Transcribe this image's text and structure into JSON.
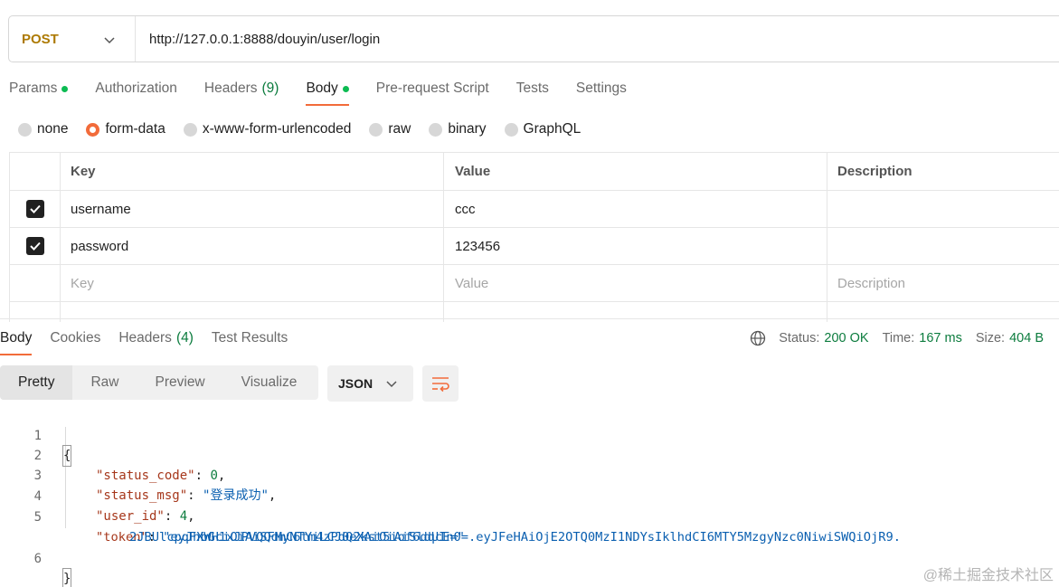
{
  "request": {
    "method": "POST",
    "url": "http://127.0.0.1:8888/douyin/user/login"
  },
  "request_tabs": [
    {
      "label": "Params",
      "dot": true
    },
    {
      "label": "Authorization"
    },
    {
      "label": "Headers",
      "count": "(9)"
    },
    {
      "label": "Body",
      "dot": true,
      "active": true
    },
    {
      "label": "Pre-request Script"
    },
    {
      "label": "Tests"
    },
    {
      "label": "Settings"
    }
  ],
  "body_types": [
    {
      "label": "none"
    },
    {
      "label": "form-data",
      "selected": true
    },
    {
      "label": "x-www-form-urlencoded"
    },
    {
      "label": "raw"
    },
    {
      "label": "binary"
    },
    {
      "label": "GraphQL"
    }
  ],
  "params_table": {
    "headers": {
      "key": "Key",
      "value": "Value",
      "description": "Description"
    },
    "rows": [
      {
        "checked": true,
        "key": "username",
        "value": "ccc",
        "description": ""
      },
      {
        "checked": true,
        "key": "password",
        "value": "123456",
        "description": ""
      }
    ],
    "placeholders": {
      "key": "Key",
      "value": "Value",
      "description": "Description"
    }
  },
  "response_tabs": [
    {
      "label": "Body",
      "active": true
    },
    {
      "label": "Cookies"
    },
    {
      "label": "Headers",
      "count": "(4)"
    },
    {
      "label": "Test Results"
    }
  ],
  "response_meta": {
    "status_label": "Status:",
    "status_value": "200 OK",
    "time_label": "Time:",
    "time_value": "167 ms",
    "size_label": "Size:",
    "size_value": "404 B"
  },
  "view_modes": [
    "Pretty",
    "Raw",
    "Preview",
    "Visualize"
  ],
  "format": "JSON",
  "code": {
    "line_numbers": [
      "1",
      "2",
      "3",
      "4",
      "5",
      "",
      "6"
    ],
    "open": "{",
    "close": "}",
    "entries": [
      {
        "key": "\"status_code\"",
        "value": "0",
        "type": "number",
        "comma": ","
      },
      {
        "key": "\"status_msg\"",
        "value": "\"登录成功\"",
        "type": "string",
        "comma": ","
      },
      {
        "key": "\"user_id\"",
        "value": "4",
        "type": "number",
        "comma": ","
      },
      {
        "key": "\"token\"",
        "value": "\"eyJhbGciOiAiSFMyNTYiLCJ0eXAiOiAiSldUIn0=.eyJFeHAiOjE2OTQ0MzI1NDYsIklhdCI6MTY5MzgyNzc0NiwiSWQiOjR9.",
        "value_cont": "2JBUlcpqFXWH1xJPVQQdmC6tm4zPdQ2kst5iof6dqcE=\"",
        "type": "string",
        "comma": ""
      }
    ]
  },
  "watermark": "@稀土掘金技术社区",
  "colors": {
    "accent": "#f26b3a",
    "method": "#ad7a03",
    "success": "#0c7c3e",
    "json_key": "#a6371b",
    "json_string": "#0a5fb0"
  }
}
